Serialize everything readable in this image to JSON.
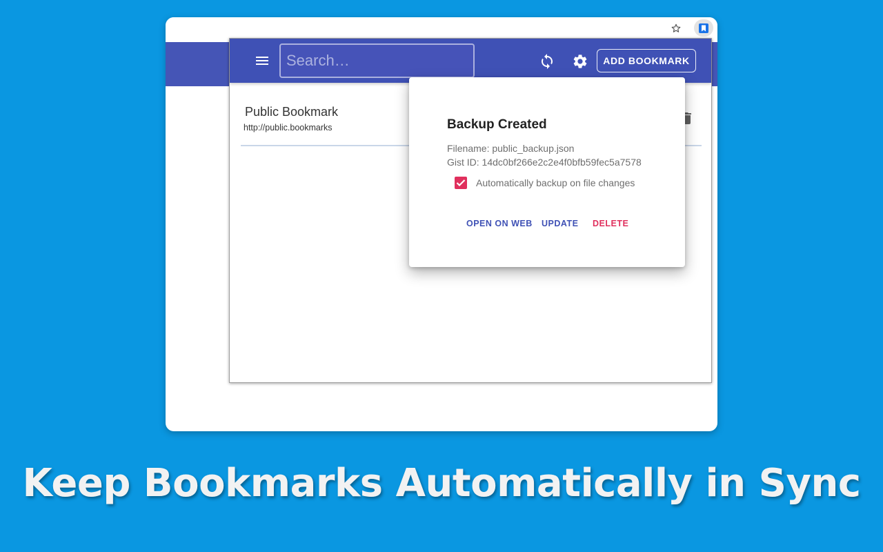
{
  "headline": "Keep Bookmarks Automatically in Sync",
  "colors": {
    "background": "#0a97e1",
    "primary": "#3f51b5",
    "accent": "#e0305d"
  },
  "browser": {
    "icons": [
      "star-icon",
      "bookmark-extension-icon"
    ]
  },
  "popup": {
    "search": {
      "placeholder": "Search…",
      "value": ""
    },
    "icons": [
      "menu-icon",
      "sync-icon",
      "gear-icon"
    ],
    "add_button_label": "ADD BOOKMARK",
    "bookmarks": [
      {
        "title": "Public Bookmark",
        "url": "http://public.bookmarks",
        "action_icon": "trash-icon"
      }
    ]
  },
  "dialog": {
    "title": "Backup Created",
    "filename_line": "Filename: public_backup.json",
    "gist_line": "Gist ID: 14dc0bf266e2c2e4f0bfb59fec5a7578",
    "auto_backup_label": "Automatically backup on file changes",
    "auto_backup_checked": true,
    "buttons": {
      "open": "OPEN ON WEB",
      "update": "UPDATE",
      "delete": "DELETE"
    }
  }
}
